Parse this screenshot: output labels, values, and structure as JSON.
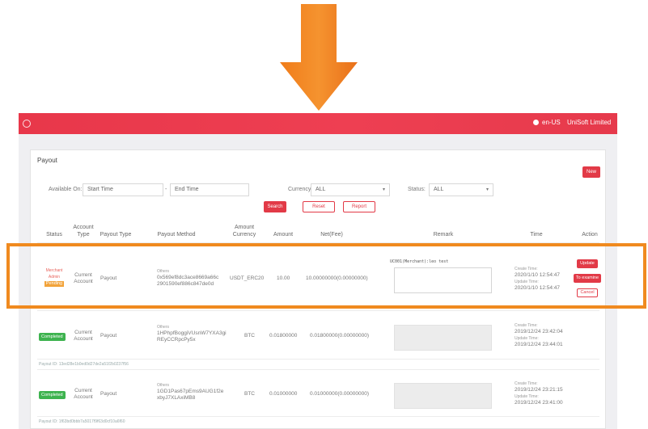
{
  "app": {
    "language": "en-US",
    "company": "UniSoft Limited"
  },
  "payout": {
    "title": "Payout",
    "new_label": "New",
    "filters": {
      "available_on_label": "Available On:",
      "start_placeholder": "Start Time",
      "separator": "-",
      "end_placeholder": "End Time",
      "currency_label": "Currency:",
      "currency_value": "ALL",
      "status_label": "Status:",
      "status_value": "ALL",
      "search_label": "Search",
      "reset_label": "Reset",
      "report_label": "Report"
    },
    "columns": {
      "status": "Status",
      "account_type": "Account Type",
      "payout_type": "Payout Type",
      "payout_method": "Payout Method",
      "amount_currency": "Amount Currency",
      "amount": "Amount",
      "net_fee": "Net(Fee)",
      "remark": "Remark",
      "time": "Time",
      "action": "Action"
    },
    "rows": [
      {
        "status_lines": [
          "Merchant",
          "Admin"
        ],
        "status_badge": "Pending",
        "account_type": "Current Account",
        "payout_type": "Payout",
        "method_label": "Others",
        "method_line1": "0x569ef8dc3ace8669a66c",
        "method_line2": "2901590ef886c847de0d",
        "currency": "USDT_ERC20",
        "amount": "10.00",
        "net_fee": "10.00000000(0.00000000)",
        "remark_note": "UC001(Merchant):leo test",
        "create_label": "Create Time:",
        "create_time": "2020/1/10 12:54:47",
        "update_label": "Update Time:",
        "update_time": "2020/1/10 12:54:47",
        "action_update": "Update",
        "action_examine": "To examine",
        "action_cancel": "Cancel"
      },
      {
        "status_badge": "Completed",
        "account_type": "Current Account",
        "payout_type": "Payout",
        "method_label": "Others",
        "method_line1": "1HPhpfBoggiVUsnW7YXA3gi",
        "method_line2": "REyCCRpcPy5x",
        "currency": "BTC",
        "amount": "0.01800000",
        "net_fee": "0.01800000(0.00000000)",
        "create_label": "Create Time:",
        "create_time": "2019/12/24 23:42:04",
        "update_label": "Update Time:",
        "update_time": "2019/12/24 23:44:01",
        "payout_id": "Payout ID: 13ed28e1b0ed0d27de2a51f2b0237f56"
      },
      {
        "status_badge": "Completed",
        "account_type": "Current Account",
        "payout_type": "Payout",
        "method_label": "Others",
        "method_line1": "1GD1Pas67pEms9AUG1f2e",
        "method_line2": "xbyJ7XLAxiMB8",
        "currency": "BTC",
        "amount": "0.01000000",
        "net_fee": "0.01000000(0.00000000)",
        "create_label": "Create Time:",
        "create_time": "2019/12/24 23:21:15",
        "update_label": "Update Time:",
        "update_time": "2019/12/24 23:41:00",
        "payout_id": "Payout ID: 1f63bd0bbb7a5017f9f63d0cf10a6f60"
      }
    ]
  },
  "colors": {
    "arrow": "#f08a1f",
    "topbar": "#e8374a",
    "accent": "#e23a47",
    "completed": "#3eb34f",
    "pending": "#f2a33a"
  }
}
